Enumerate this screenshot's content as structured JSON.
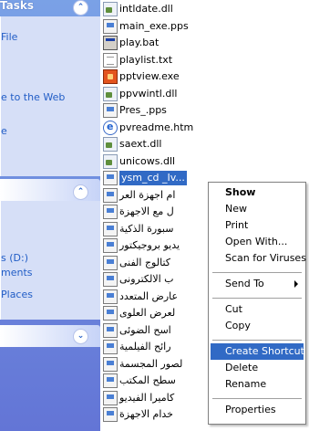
{
  "task_pane": {
    "header1": {
      "title": "Tasks"
    },
    "links1": [
      "File",
      "e to the Web",
      "e"
    ],
    "header2": {
      "title": ""
    },
    "links2": [
      "s (D:)",
      "ments",
      "Places"
    ]
  },
  "files": [
    {
      "name": "intldate.dll",
      "icon": "dll-file-icon"
    },
    {
      "name": "main_exe.pps",
      "icon": "pps-file-icon"
    },
    {
      "name": "play.bat",
      "icon": "bat-file-icon"
    },
    {
      "name": "playlist.txt",
      "icon": "text-file-icon"
    },
    {
      "name": "pptview.exe",
      "icon": "exe-file-icon"
    },
    {
      "name": "ppvwintl.dll",
      "icon": "dll-file-icon"
    },
    {
      "name": "Pres_.pps",
      "icon": "pps-file-icon"
    },
    {
      "name": "pvreadme.htm",
      "icon": "htm-file-icon"
    },
    {
      "name": "saext.dll",
      "icon": "dll-file-icon"
    },
    {
      "name": "unicows.dll",
      "icon": "dll-file-icon"
    },
    {
      "name": "ysm_cd _Iv...",
      "icon": "pps-file-icon",
      "selected": true
    },
    {
      "name": "ام اجهزة العر",
      "icon": "pps-file-icon"
    },
    {
      "name": "ل مع الاجهزة",
      "icon": "pps-file-icon"
    },
    {
      "name": "سبورة الذكية",
      "icon": "pps-file-icon"
    },
    {
      "name": "يديو بروجيكتور",
      "icon": "pps-file-icon"
    },
    {
      "name": "كتالوج الفنى",
      "icon": "pps-file-icon"
    },
    {
      "name": "ب الالكترونى",
      "icon": "pps-file-icon"
    },
    {
      "name": "عارض المتعدد",
      "icon": "pps-file-icon"
    },
    {
      "name": "لعرض العلوى",
      "icon": "pps-file-icon"
    },
    {
      "name": "اسح الضوئى",
      "icon": "pps-file-icon"
    },
    {
      "name": "رائح الفيلمية",
      "icon": "pps-file-icon"
    },
    {
      "name": "لصور المجسمة",
      "icon": "pps-file-icon"
    },
    {
      "name": "سطح المكتب",
      "icon": "pps-file-icon"
    },
    {
      "name": "كاميرا الفيديو",
      "icon": "pps-file-icon"
    },
    {
      "name": "خدام الاجهزة",
      "icon": "pps-file-icon"
    }
  ],
  "context_menu": {
    "show": "Show",
    "new": "New",
    "print": "Print",
    "open_with": "Open With...",
    "scan": "Scan for Viruses",
    "send_to": "Send To",
    "cut": "Cut",
    "copy": "Copy",
    "create_shortcut": "Create Shortcut",
    "delete": "Delete",
    "rename": "Rename",
    "properties": "Properties"
  },
  "colors": {
    "selection": "#316ac5",
    "taskpane_gradient_top": "#7aa1e6",
    "taskpane_gradient_bottom": "#6375d6",
    "link": "#215dc6"
  }
}
